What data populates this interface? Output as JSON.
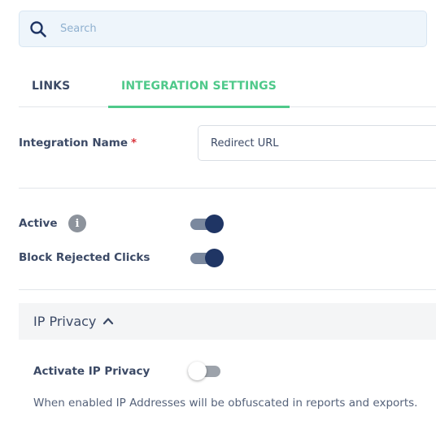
{
  "search": {
    "placeholder": "Search",
    "icon": "search-icon"
  },
  "tabs": [
    {
      "label": "LINKS",
      "active": false
    },
    {
      "label": "INTEGRATION SETTINGS",
      "active": true
    }
  ],
  "colors": {
    "accent": "#4fc98a",
    "toggle_on": "#1f3564",
    "required": "#d9363e",
    "text": "#3c4a66"
  },
  "form": {
    "integration_name": {
      "label": "Integration Name",
      "required_mark": "*",
      "value": "Redirect URL"
    },
    "active": {
      "label": "Active",
      "enabled": true,
      "info_icon": "i"
    },
    "block_rejected_clicks": {
      "label": "Block Rejected Clicks",
      "enabled": true
    }
  },
  "ip_privacy": {
    "title": "IP Privacy",
    "expanded": true,
    "activate": {
      "label": "Activate IP Privacy",
      "enabled": false
    },
    "help_text": "When enabled IP Addresses will be obfuscated in reports and exports."
  }
}
